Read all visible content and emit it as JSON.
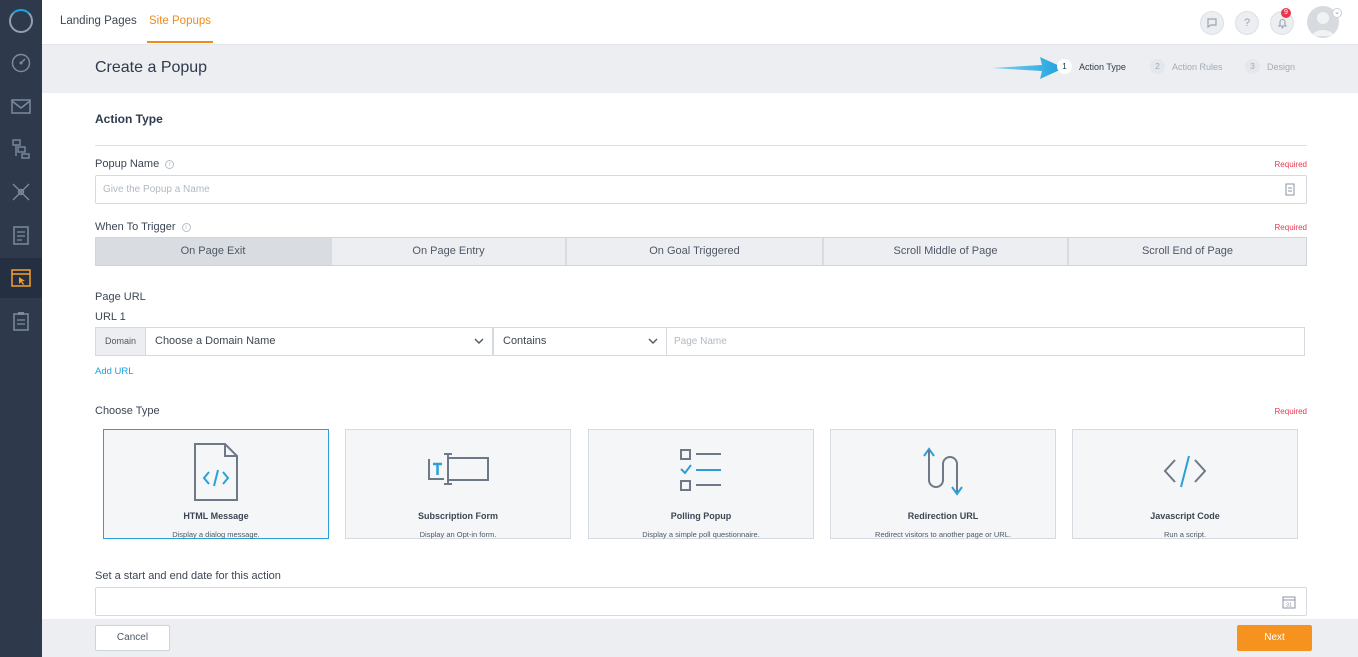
{
  "colors": {
    "accent": "#f08a1c",
    "link": "#1da1e0",
    "required": "#e8384f",
    "rail": "#2e3a4b",
    "next_button": "#f6921e",
    "selected_card_border": "#2ba0d8"
  },
  "rail": {
    "icons": [
      "logo-ring-icon",
      "dashboard-gauge-icon",
      "email-icon",
      "automation-flow-icon",
      "network-icon",
      "document-icon",
      "site-popups-icon",
      "clipboard-icon"
    ],
    "active": "site-popups-icon"
  },
  "topbar": {
    "tabs": [
      {
        "label": "Landing Pages"
      },
      {
        "label": "Site Popups"
      }
    ],
    "active_tab": "Site Popups",
    "help_label": "?",
    "notification_count": "9"
  },
  "header": {
    "title": "Create a Popup",
    "steps": [
      {
        "num": "1",
        "label": "Action Type"
      },
      {
        "num": "2",
        "label": "Action Rules"
      },
      {
        "num": "3",
        "label": "Design"
      }
    ],
    "active_step": "1"
  },
  "form": {
    "section_title": "Action Type",
    "popup_name": {
      "label": "Popup Name",
      "required": "Required",
      "placeholder": "Give the Popup a Name",
      "value": "",
      "info": "i"
    },
    "trigger": {
      "label": "When To Trigger",
      "required": "Required",
      "info": "i",
      "options": [
        "On Page Exit",
        "On Page Entry",
        "On Goal Triggered",
        "Scroll Middle of Page",
        "Scroll End of Page"
      ],
      "selected": "On Page Exit"
    },
    "page_url": {
      "label": "Page URL",
      "url_label": "URL 1",
      "domain_tag": "Domain",
      "domain_select": "Choose a Domain Name",
      "match_select": "Contains",
      "page_name_placeholder": "Page Name",
      "add_url": "Add URL"
    },
    "choose_type": {
      "label": "Choose Type",
      "required": "Required",
      "selected": "HTML Message",
      "types": [
        {
          "title": "HTML Message",
          "desc": "Display a dialog message.",
          "icon": "html-file-icon"
        },
        {
          "title": "Subscription Form",
          "desc": "Display an Opt-in form.",
          "icon": "text-field-icon"
        },
        {
          "title": "Polling Popup",
          "desc": "Display a simple poll questionnaire.",
          "icon": "checklist-icon"
        },
        {
          "title": "Redirection URL",
          "desc": "Redirect visitors to another page or URL.",
          "icon": "redirect-arrows-icon"
        },
        {
          "title": "Javascript Code",
          "desc": "Run a script.",
          "icon": "code-brackets-icon"
        }
      ]
    },
    "date_range": {
      "label": "Set a start and end date for this action",
      "value": "",
      "icon": "calendar-icon",
      "calendar_day": "31"
    }
  },
  "footer": {
    "cancel": "Cancel",
    "next": "Next"
  }
}
